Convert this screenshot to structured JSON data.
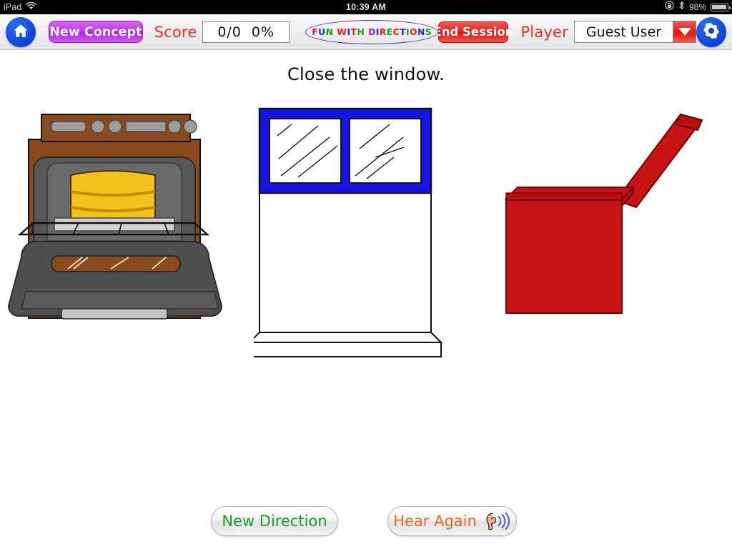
{
  "status_bar": {
    "device": "iPad",
    "wifi_icon": "wifi-icon",
    "time": "10:39 AM",
    "rotation_lock_icon": "rotation-lock-icon",
    "bluetooth_icon": "bluetooth-icon",
    "battery_percent": "98%",
    "battery_icon": "battery-icon"
  },
  "toolbar": {
    "home_icon": "home-icon",
    "new_concept_label": "New Concept",
    "score_label": "Score",
    "score_value": "0/0",
    "score_percent": "0%",
    "logo": {
      "text": "FUN WITH DIRECTIONS",
      "letters": [
        {
          "ch": "F",
          "color": "#e81f1f"
        },
        {
          "ch": "U",
          "color": "#2a2ad8"
        },
        {
          "ch": "N",
          "color": "#14a317"
        },
        {
          "ch": " ",
          "color": "#000000"
        },
        {
          "ch": "W",
          "color": "#e81f1f"
        },
        {
          "ch": "I",
          "color": "#2a2ad8"
        },
        {
          "ch": "T",
          "color": "#e81f1f"
        },
        {
          "ch": "H",
          "color": "#14a317"
        },
        {
          "ch": " ",
          "color": "#000000"
        },
        {
          "ch": "D",
          "color": "#a21fd1"
        },
        {
          "ch": "I",
          "color": "#2a2ad8"
        },
        {
          "ch": "R",
          "color": "#e81f1f"
        },
        {
          "ch": "E",
          "color": "#14a317"
        },
        {
          "ch": "C",
          "color": "#e81f1f"
        },
        {
          "ch": "T",
          "color": "#2a2ad8"
        },
        {
          "ch": "I",
          "color": "#14a317"
        },
        {
          "ch": "O",
          "color": "#e81f1f"
        },
        {
          "ch": "N",
          "color": "#2a2ad8"
        },
        {
          "ch": "S",
          "color": "#14a317"
        }
      ],
      "ellipse_color": "#3a37c9"
    },
    "end_session_label": "End Session",
    "player_label": "Player",
    "player_value": "Guest User",
    "player_dropdown_icon": "chevron-down-icon",
    "settings_icon": "gear-icon"
  },
  "prompt": {
    "text": "Close the window."
  },
  "choices": [
    {
      "name": "oven-with-cake",
      "alt": "Open oven with a yellow layer cake on the rack",
      "colors": {
        "body": "#8a4a1e",
        "metal": "#5d5d5d",
        "cake": "#f5c21b",
        "cake_dark": "#e0a000"
      }
    },
    {
      "name": "open-window",
      "alt": "Open window with blue frame raised above the sill",
      "colors": {
        "frame": "#1414e6",
        "glass": "#ffffff",
        "outline": "#000000"
      }
    },
    {
      "name": "open-box",
      "alt": "Open red box with the lid flipped up",
      "colors": {
        "box": "#c81414",
        "lid_top": "#b81010",
        "outline": "#6d0000"
      }
    }
  ],
  "bottom_bar": {
    "new_direction_label": "New Direction",
    "new_direction_color": "#169b2e",
    "hear_again_label": "Hear Again",
    "hear_again_color": "#ec6a18",
    "hear_again_icon": "ear-icon"
  }
}
